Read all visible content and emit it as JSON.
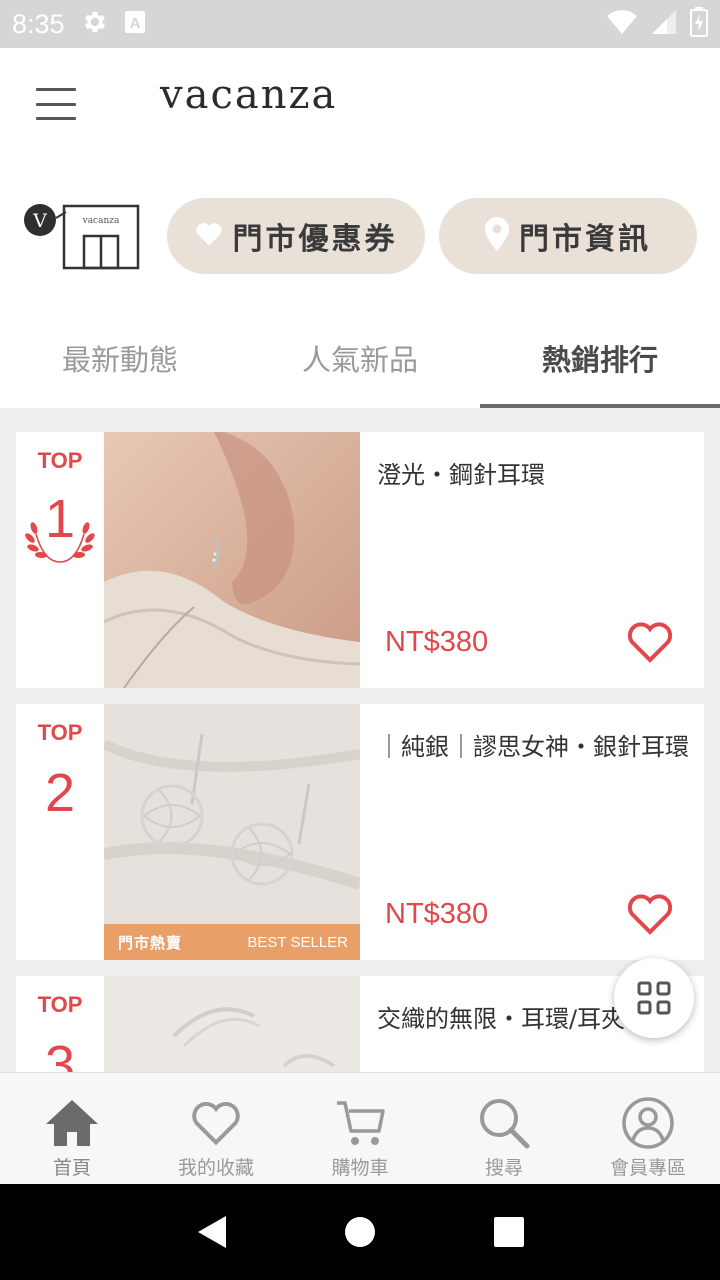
{
  "status_bar": {
    "time": "8:35",
    "icons": [
      "gear-icon",
      "keyboard-a-icon",
      "wifi-icon",
      "signal-icon",
      "battery-icon"
    ]
  },
  "header": {
    "brand": "vacanza",
    "menu_icon": "hamburger-icon"
  },
  "store_row": {
    "store_icon": "storefront-icon",
    "store_logo_text": "vacanza",
    "coupon_button": "門市優惠券",
    "info_button": "門市資訊"
  },
  "tabs": [
    {
      "label": "最新動態",
      "active": false
    },
    {
      "label": "人氣新品",
      "active": false
    },
    {
      "label": "熱銷排行",
      "active": true
    }
  ],
  "products": [
    {
      "rank_label": "TOP",
      "rank": "1",
      "name": "澄光・鋼針耳環",
      "price": "NT$380",
      "badge": null
    },
    {
      "rank_label": "TOP",
      "rank": "2",
      "name": "｜純銀｜謬思女神・銀針耳環",
      "price": "NT$380",
      "badge": {
        "left": "門市熱賣",
        "right": "BEST SELLER"
      }
    },
    {
      "rank_label": "TOP",
      "rank": "3",
      "name": "交織的無限・耳環/耳夾",
      "price": "",
      "badge": null
    }
  ],
  "fab_icon": "grid-icon",
  "bottom_nav": [
    {
      "label": "首頁",
      "icon": "home-icon",
      "active": true
    },
    {
      "label": "我的收藏",
      "icon": "heart-icon",
      "active": false
    },
    {
      "label": "購物車",
      "icon": "cart-icon",
      "active": false
    },
    {
      "label": "搜尋",
      "icon": "search-icon",
      "active": false
    },
    {
      "label": "會員專區",
      "icon": "user-icon",
      "active": false
    }
  ],
  "colors": {
    "accent_red": "#e2474b",
    "pill_bg": "#e9e0d8",
    "badge_orange": "#e89f68",
    "status_bar": "#d6d6d6"
  }
}
